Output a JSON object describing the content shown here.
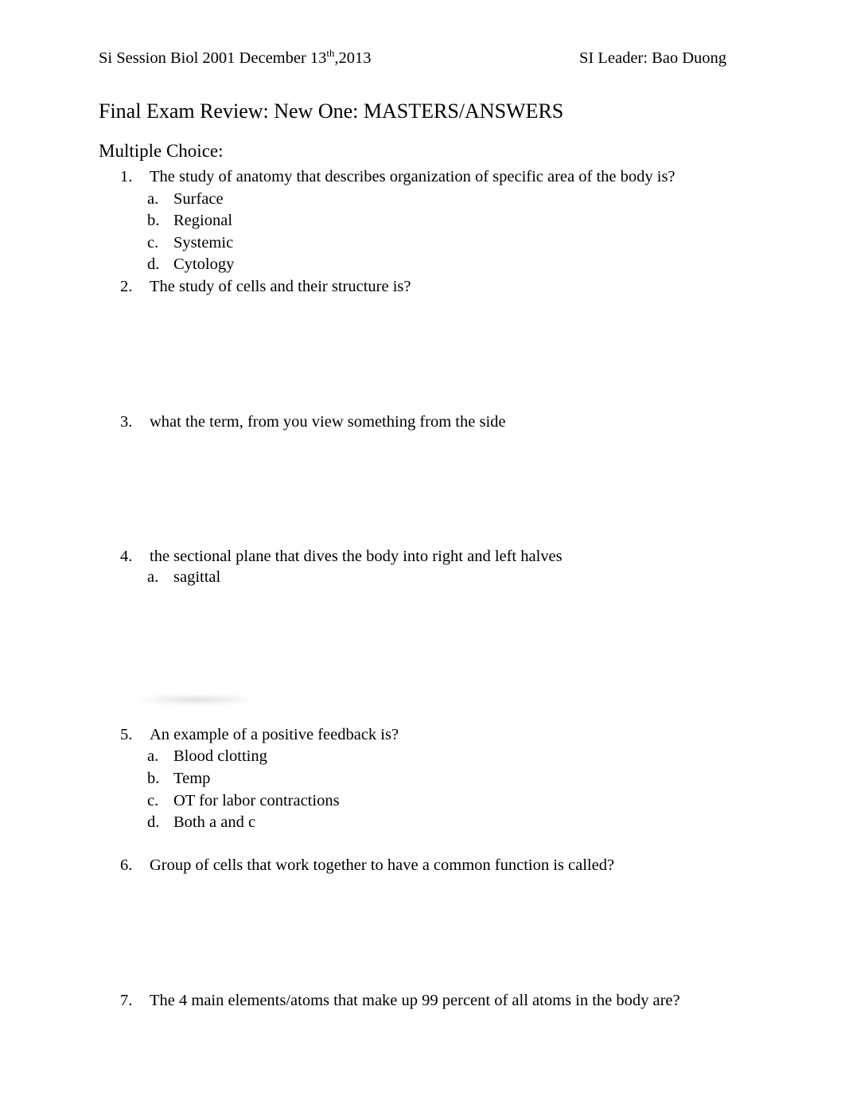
{
  "document": {
    "background_color": "#ffffff",
    "text_color": "#000000"
  },
  "header": {
    "left": "Si Session Biol 2001 December 13",
    "left_superscript": "th",
    "left_suffix": ",2013",
    "right": "SI Leader: Bao Duong"
  },
  "title": "Final Exam Review: New One: MASTERS/ANSWERS",
  "section": {
    "heading": "Multiple Choice:"
  },
  "questions": [
    {
      "marker": "1.",
      "text": "The study of anatomy that describes organization of specific area of the body is?",
      "options": [
        {
          "marker": "a.",
          "text": "Surface"
        },
        {
          "marker": "b.",
          "text": "Regional"
        },
        {
          "marker": "c.",
          "text": "Systemic"
        },
        {
          "marker": "d.",
          "text": "Cytology"
        }
      ]
    },
    {
      "marker": "2.",
      "text": "The study of cells and their structure is?",
      "options": []
    },
    {
      "marker": "3.",
      "text": "what the term, from you view something from the side",
      "options": []
    },
    {
      "marker": "4.",
      "text": "the sectional plane that dives the body into right and left halves",
      "options": [
        {
          "marker": "a.",
          "text": "sagittal"
        }
      ]
    },
    {
      "marker": "5.",
      "text": "An example of a positive feedback is?",
      "options": [
        {
          "marker": "a.",
          "text": "Blood clotting"
        },
        {
          "marker": "b.",
          "text": "Temp"
        },
        {
          "marker": "c.",
          "text": "OT for labor contractions"
        },
        {
          "marker": "d.",
          "text": "Both a and c"
        }
      ]
    },
    {
      "marker": "6.",
      "text": "Group of cells that work together to have a common function is called?",
      "options": []
    },
    {
      "marker": "7.",
      "text": "The 4 main elements/atoms that make up 99 percent of all atoms in the body are?",
      "options": []
    }
  ],
  "layout": {
    "question_tops": [
      209,
      347,
      517,
      686,
      910,
      1074,
      1244
    ],
    "option_tops": [
      [
        237,
        264,
        292,
        319
      ],
      [],
      [],
      [
        712
      ],
      [
        937,
        965,
        993,
        1020
      ],
      [],
      []
    ]
  }
}
